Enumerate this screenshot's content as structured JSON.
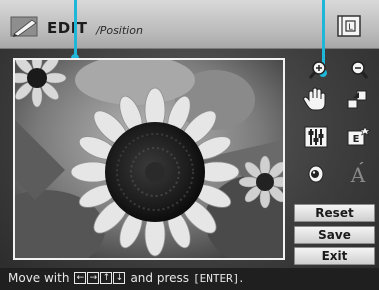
{
  "header": {
    "title": "EDIT",
    "subtitle": "/Position",
    "left_icon": "edit-pencil-icon",
    "right_icon": "book-index-icon"
  },
  "photo": {
    "subject": "sunflower"
  },
  "tools": [
    {
      "name": "zoom-in-icon",
      "interactable": true
    },
    {
      "name": "zoom-out-icon",
      "interactable": true
    },
    {
      "name": "move-hand-icon",
      "interactable": true
    },
    {
      "name": "rotate-icon",
      "interactable": true
    },
    {
      "name": "adjust-filter-icon",
      "interactable": true
    },
    {
      "name": "effect-icon",
      "interactable": true
    },
    {
      "name": "red-eye-icon",
      "interactable": true
    },
    {
      "name": "text-icon",
      "interactable": false
    }
  ],
  "buttons": {
    "reset": "Reset",
    "save": "Save",
    "exit": "Exit"
  },
  "footer": {
    "prefix": "Move with",
    "keys": [
      "←",
      "→",
      "↑",
      "↓"
    ],
    "middle": "and press",
    "enter": "[ENTER]",
    "suffix": "."
  },
  "colors": {
    "pointer": "#1fb7d9",
    "header_bg": "#c8c8c8",
    "footer_bg": "#1f1f1f"
  }
}
